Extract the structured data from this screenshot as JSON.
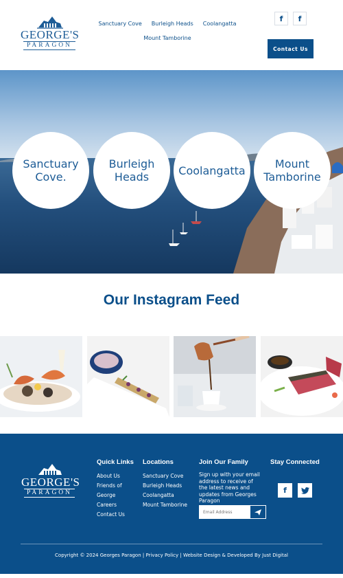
{
  "header": {
    "logo": {
      "name": "GEORGE'S",
      "sub": "PARAGON"
    },
    "nav": [
      "Sanctuary Cove",
      "Burleigh Heads",
      "Coolangatta",
      "Mount Tamborine"
    ],
    "social": [
      "facebook-icon",
      "facebook-icon"
    ],
    "social_glyph": "f",
    "contact_label": "Contact Us"
  },
  "hero": {
    "locations": [
      "Sanctuary\nCove.",
      "Burleigh\nHeads",
      "Coolangatta",
      "Mount\nTamborine"
    ]
  },
  "instagram": {
    "title": "Our Instagram Feed"
  },
  "footer": {
    "logo": {
      "name": "GEORGE'S",
      "sub": "PARAGON"
    },
    "quick_links": {
      "title": "Quick Links",
      "items": [
        "About Us",
        "Friends of",
        "George",
        "Careers",
        "Contact Us"
      ]
    },
    "locations": {
      "title": "Locations",
      "items": [
        "Sanctuary Cove",
        "Burleigh Heads",
        "Coolangatta",
        "Mount Tamborine"
      ]
    },
    "join": {
      "title": "Join Our Family",
      "text": "Sign up with your email address to receive of the latest news and updates from Georges Paragon",
      "placeholder": "Email Address"
    },
    "stay": {
      "title": "Stay Connected",
      "facebook_glyph": "f",
      "twitter_glyph": "🐦"
    },
    "copyright": "Copyright © 2024 Georges Paragon | Privacy Policy | Website Design & Developed By Just Digital"
  },
  "colors": {
    "brand_blue": "#0b4f8a",
    "white": "#ffffff"
  }
}
